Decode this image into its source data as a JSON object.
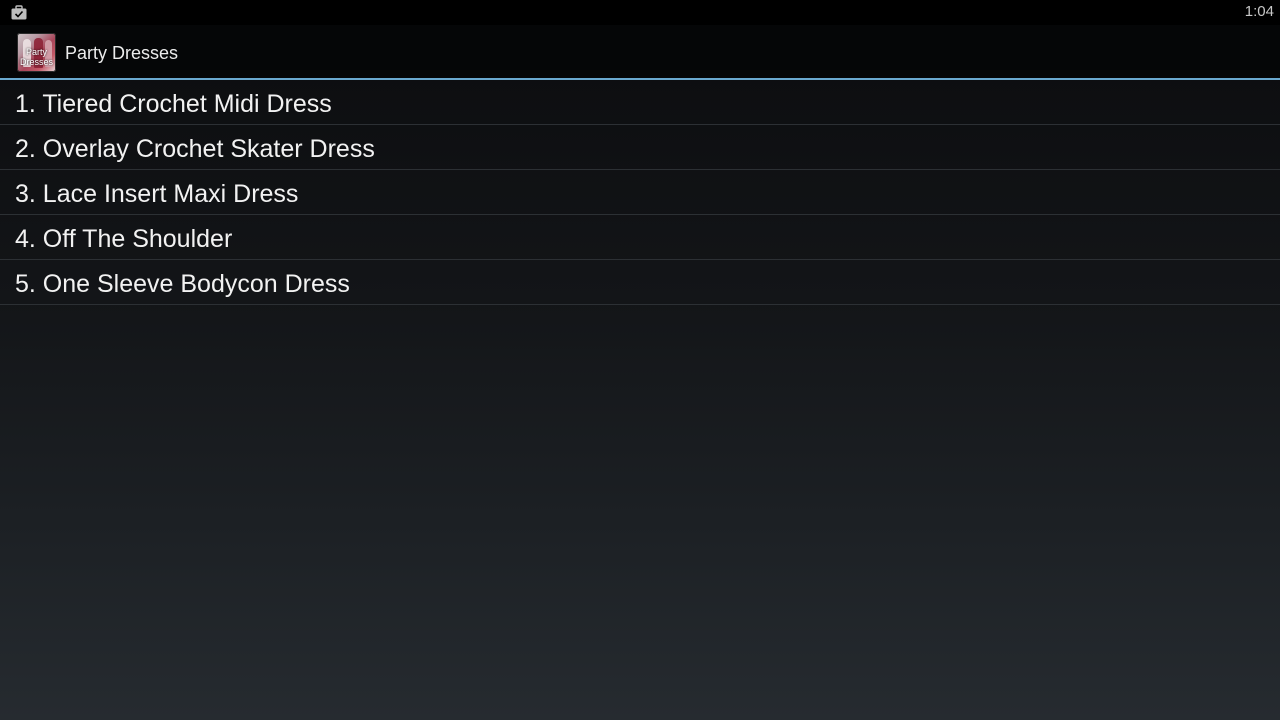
{
  "status_bar": {
    "time": "1:04",
    "notification_icon": "briefcase-check-icon"
  },
  "action_bar": {
    "title": "Party Dresses",
    "app_icon": {
      "name": "party-dresses-app-icon",
      "text_line1": "Party",
      "text_line2": "Dresses"
    },
    "accent_color": "#6aa9cf"
  },
  "list": {
    "items": [
      {
        "label": "1. Tiered Crochet Midi Dress"
      },
      {
        "label": "2. Overlay Crochet Skater Dress"
      },
      {
        "label": "3. Lace Insert Maxi Dress"
      },
      {
        "label": "4. Off The Shoulder"
      },
      {
        "label": "5. One Sleeve Bodycon Dress"
      }
    ]
  }
}
